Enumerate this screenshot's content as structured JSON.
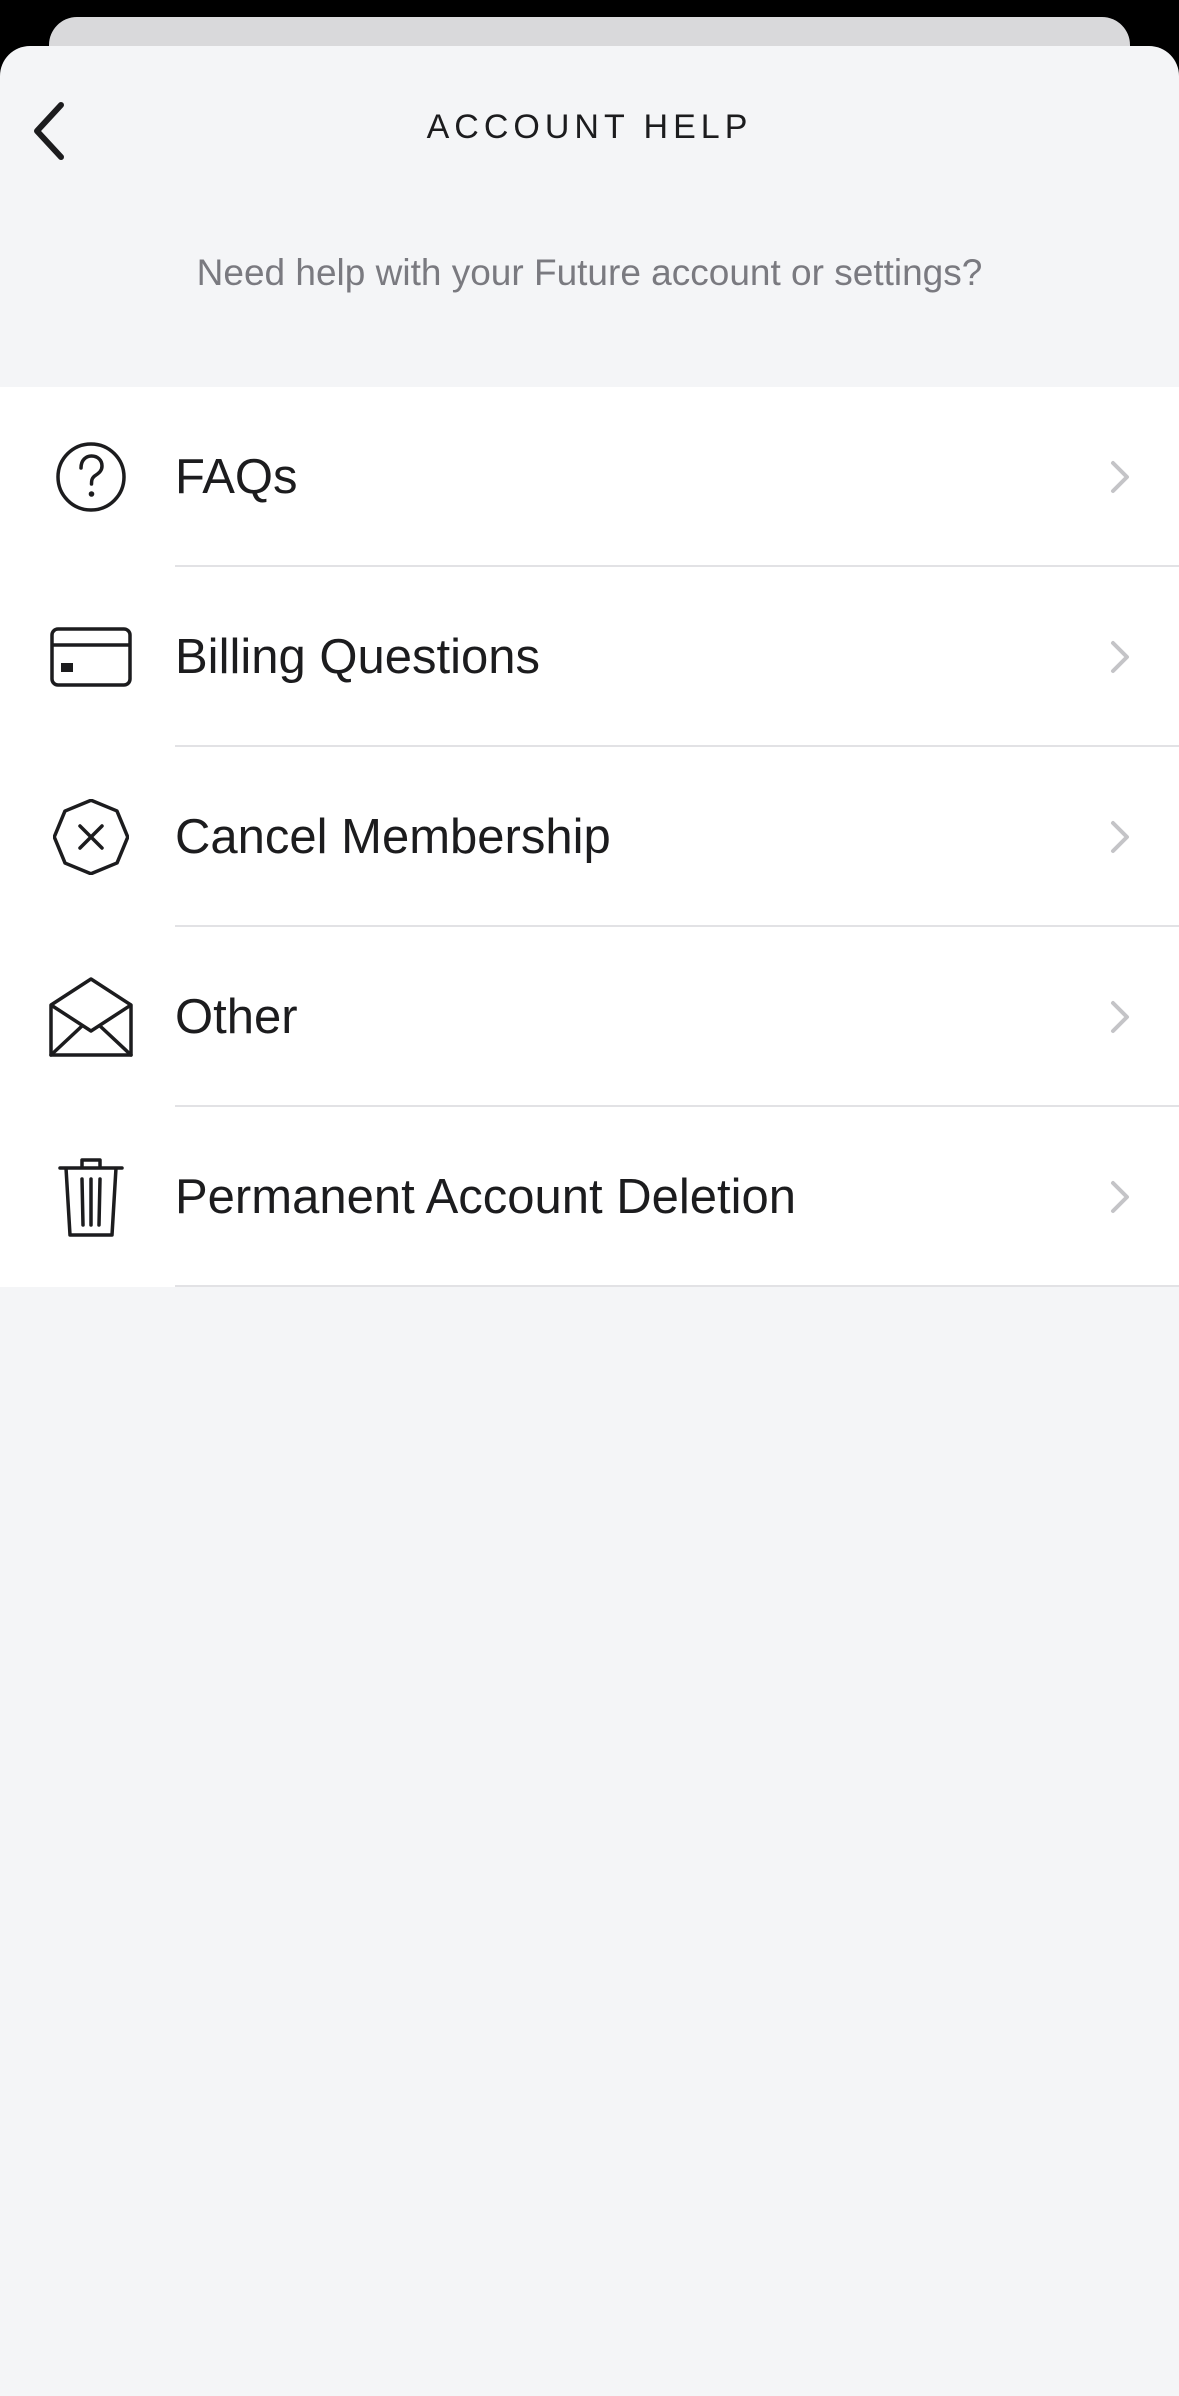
{
  "header": {
    "title": "ACCOUNT HELP",
    "subtitle": "Need help with your Future account or settings?"
  },
  "menu": {
    "items": [
      {
        "label": "FAQs",
        "icon": "question-circle-icon"
      },
      {
        "label": "Billing Questions",
        "icon": "credit-card-icon"
      },
      {
        "label": "Cancel Membership",
        "icon": "cancel-octagon-icon"
      },
      {
        "label": "Other",
        "icon": "envelope-open-icon"
      },
      {
        "label": "Permanent Account Deletion",
        "icon": "trash-icon"
      }
    ]
  },
  "colors": {
    "background": "#f4f5f7",
    "row_background": "#ffffff",
    "text_primary": "#1c1c1e",
    "text_secondary": "#7a7a80",
    "chevron": "#c4c4c7",
    "divider": "#e2e2e5"
  }
}
